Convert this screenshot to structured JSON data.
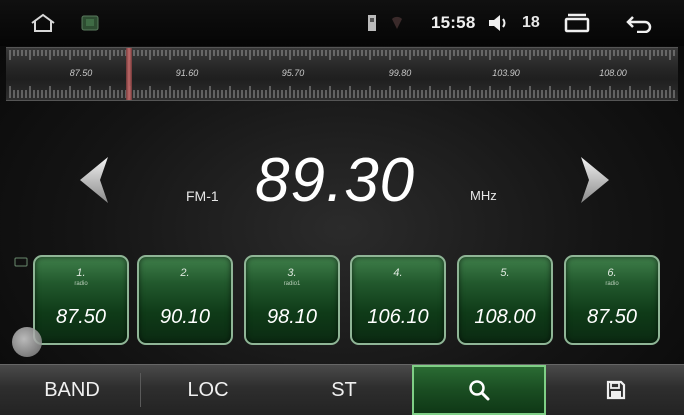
{
  "status_bar": {
    "time": "15:58",
    "volume": "18",
    "icons": [
      "home-icon",
      "thumbnail-icon",
      "sd-card-icon",
      "signal-icon",
      "volume-icon",
      "recent-apps-icon",
      "back-icon"
    ]
  },
  "ruler": {
    "labels": [
      "87.50",
      "91.60",
      "95.70",
      "99.80",
      "103.90",
      "108.00"
    ],
    "current_marker": "needle"
  },
  "tuner": {
    "band": "FM-1",
    "frequency": "89.30",
    "unit": "MHz"
  },
  "presets": [
    {
      "num": "1.",
      "name": "radio",
      "freq": "87.50"
    },
    {
      "num": "2.",
      "name": "",
      "freq": "90.10"
    },
    {
      "num": "3.",
      "name": "radio1",
      "freq": "98.10"
    },
    {
      "num": "4.",
      "name": "",
      "freq": "106.10"
    },
    {
      "num": "5.",
      "name": "",
      "freq": "108.00"
    },
    {
      "num": "6.",
      "name": "radio",
      "freq": "87.50"
    }
  ],
  "bottom_bar": {
    "band_label": "BAND",
    "loc_label": "LOC",
    "st_label": "ST",
    "search_icon": "search-icon",
    "save_icon": "save-icon"
  },
  "colors": {
    "accent_green": "#1a4d22",
    "preset_border": "#8fb596",
    "needle": "#d07070"
  }
}
